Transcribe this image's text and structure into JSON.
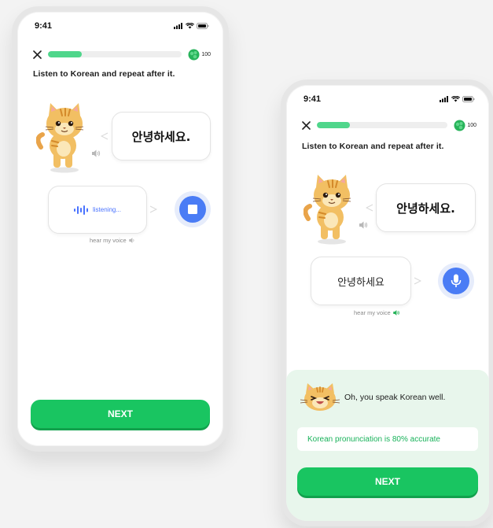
{
  "screens": [
    {
      "status_time": "9:41",
      "progress": 0.25,
      "points": "100",
      "instruction": "Listen to Korean and repeat after it.",
      "prompt_text": "안녕하세요.",
      "user_state_label": "listening...",
      "hear_voice_label": "hear my voice",
      "mic_state": "recording-stop",
      "next_label": "NEXT"
    },
    {
      "status_time": "9:41",
      "progress": 0.25,
      "points": "100",
      "instruction": "Listen to Korean and repeat after it.",
      "prompt_text": "안녕하세요.",
      "user_transcript": "안녕하세요",
      "hear_voice_label": "hear my voice",
      "mic_state": "microphone",
      "feedback_message": "Oh, you speak Korean well.",
      "accuracy_text": "Korean pronunciation is 80% accurate",
      "next_label": "NEXT"
    }
  ],
  "colors": {
    "accent_green": "#19c561",
    "progress_green": "#4fd68b",
    "mic_blue": "#4a7cf5",
    "feedback_bg": "#e8f6ec",
    "accuracy_text": "#18b25a"
  },
  "icons": [
    "close-icon",
    "points-coin-icon",
    "speaker-icon",
    "voice-wave-icon",
    "stop-icon",
    "microphone-icon",
    "cat-mascot-icon"
  ]
}
